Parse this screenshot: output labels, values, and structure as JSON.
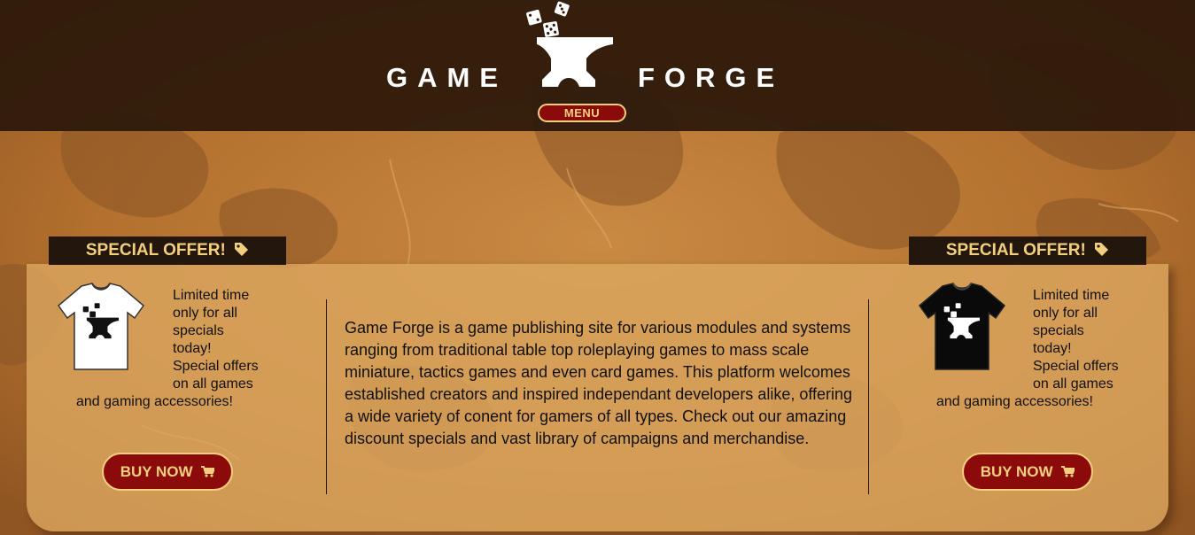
{
  "colors": {
    "header_bg": "#2b180a",
    "accent_red": "#8b0a0a",
    "accent_gold": "#f2cf7e",
    "panel_bg": "#dca760",
    "map_base": "#b5712e"
  },
  "header": {
    "brand_left": "GAME",
    "brand_right": "FORGE",
    "logo_icon": "anvil-dice-icon",
    "menu_label": "MENU"
  },
  "offers": [
    {
      "tab_label": "SPECIAL OFFER!",
      "tab_icon": "tag-icon",
      "shirt_color": "white",
      "text_lines": [
        "Limited time",
        "only for all",
        "specials",
        "today!",
        "Special offers",
        "on all games"
      ],
      "last_line": "and gaming accessories!",
      "button_label": "BUY NOW",
      "button_icon": "cart-icon"
    },
    {
      "tab_label": "SPECIAL OFFER!",
      "tab_icon": "tag-icon",
      "shirt_color": "black",
      "text_lines": [
        "Limited time",
        "only for all",
        "specials",
        "today!",
        "Special offers",
        "on all games"
      ],
      "last_line": "and gaming accessories!",
      "button_label": "BUY NOW",
      "button_icon": "cart-icon"
    }
  ],
  "main": {
    "description": "Game Forge is a game publishing site for various modules and systems ranging from traditional table top roleplaying games to mass scale miniature, tactics games and even card games. This platform welcomes established creators and inspired independant developers alike, offering a wide variety of conent for gamers of all types. Check out our amazing discount specials and vast library of campaigns and merchandise."
  }
}
